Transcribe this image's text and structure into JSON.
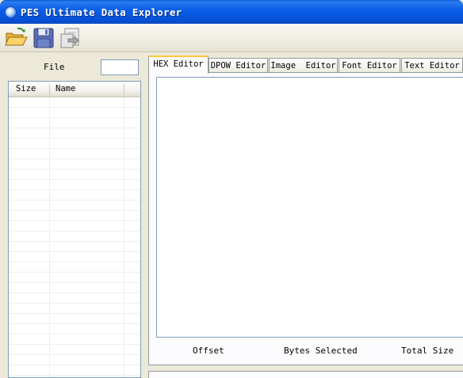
{
  "window": {
    "title": "PES Ultimate Data Explorer"
  },
  "toolbar": {
    "buttons": [
      {
        "icon": "open-folder-icon"
      },
      {
        "icon": "save-icon"
      },
      {
        "icon": "export-icon"
      }
    ]
  },
  "left_panel": {
    "file_label": "File",
    "file_value": "",
    "list": {
      "columns": [
        "Size",
        "Name"
      ],
      "rows": []
    }
  },
  "tabs": [
    {
      "label": "HEX Editor",
      "active": true
    },
    {
      "label": "DPOW Editor",
      "active": false
    },
    {
      "label": "Image  Editor",
      "active": false
    },
    {
      "label": "Font Editor",
      "active": false
    },
    {
      "label": "Text Editor",
      "active": false
    }
  ],
  "hex_editor": {
    "offset_label": "Offset",
    "bytes_selected_label": "Bytes Selected",
    "total_size_label": "Total Size"
  }
}
